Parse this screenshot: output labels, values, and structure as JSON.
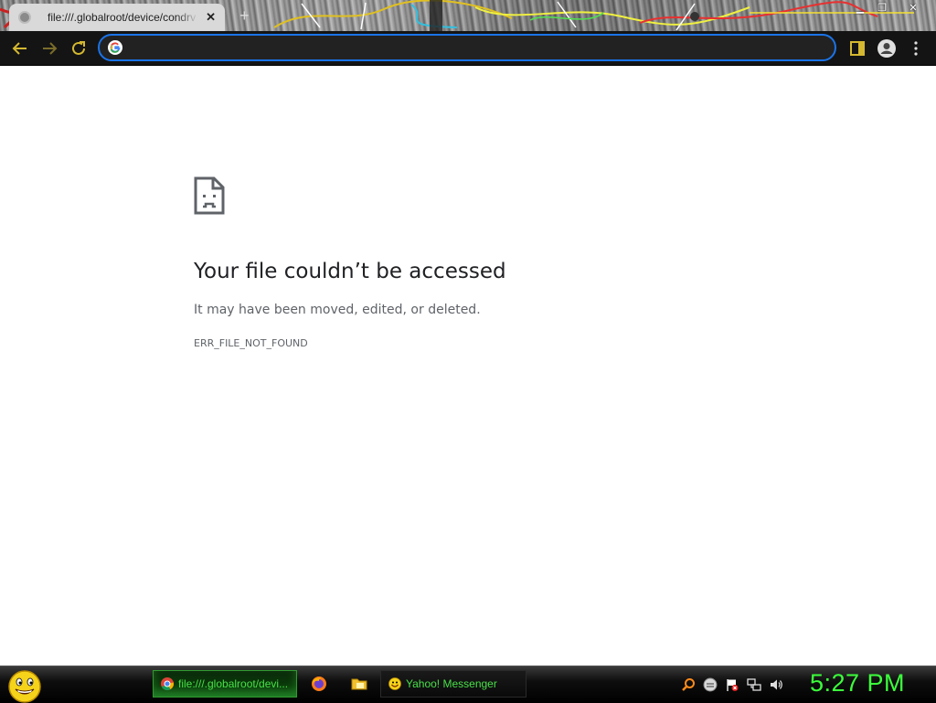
{
  "tab": {
    "title": "file:///.globalroot/device/condrv",
    "close_icon": "close-icon",
    "new_tab_icon": "plus-icon"
  },
  "window": {
    "minimize_icon": "minimize-icon",
    "restore_icon": "restore-icon",
    "close_icon": "close-icon"
  },
  "toolbar": {
    "back_icon": "arrow-left-icon",
    "forward_icon": "arrow-right-icon",
    "reload_icon": "reload-icon",
    "omnibox_value": "",
    "omnibox_icon": "google-g-icon",
    "side_panel_icon": "side-panel-icon",
    "profile_icon": "profile-icon",
    "menu_icon": "kebab-menu-icon",
    "accent_color": "#1a73e8"
  },
  "error_page": {
    "icon": "sad-document-icon",
    "title": "Your file couldn’t be accessed",
    "subtitle": "It may have been moved, edited, or deleted.",
    "code": "ERR_FILE_NOT_FOUND"
  },
  "taskbar": {
    "start_icon": "smiley-start-icon",
    "tasks": [
      {
        "label": "file:///.globalroot/devi...",
        "icon": "chrome-icon",
        "active": true
      },
      {
        "label": "Yahoo! Messenger",
        "icon": "yahoo-smiley-icon",
        "active": false
      }
    ],
    "quick_launch": [
      "firefox-icon",
      "folder-icon"
    ],
    "tray": [
      "search-icon",
      "messenger-tray-icon",
      "flag-icon",
      "network-icon",
      "volume-icon"
    ],
    "clock": "5:27 PM",
    "clock_color": "#3cff3c"
  }
}
